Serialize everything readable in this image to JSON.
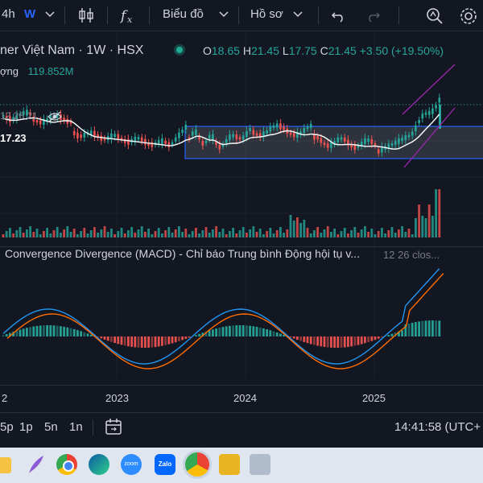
{
  "toolbar": {
    "interval": "4h",
    "interval_active": "W",
    "chart_type_label": "Biểu đồ",
    "profile_label": "Hồ sơ"
  },
  "legend": {
    "symbol_title": "ner Việt Nam · 1W · HSX",
    "open_label": "O",
    "open_value": "18.65",
    "high_label": "H",
    "high_value": "21.45",
    "low_label": "L",
    "low_value": "17.75",
    "close_label": "C",
    "close_value": "21.45",
    "change": "+3.50 (+19.50%)",
    "volume_label": "ợng",
    "volume_value": "119.852M",
    "ma_label": "12 26 21",
    "ma_value": "17.23"
  },
  "macd": {
    "title": "Convergence Divergence (MACD) - Chỉ báo Trung bình Động hội tụ v...",
    "params": "12 26 clos..."
  },
  "time_axis": [
    "2",
    "2023",
    "2024",
    "2025"
  ],
  "bottombar": {
    "ranges": [
      "5p",
      "1p",
      "5n",
      "1n"
    ],
    "clock": "14:41:58 (UTC+"
  },
  "taskbar": {
    "icons": [
      "folder-icon",
      "feather-icon",
      "chrome-icon",
      "edge-icon",
      "zoom-icon",
      "zalo-icon",
      "chrome-profile-icon",
      "lock-icon",
      "snipping-icon"
    ],
    "zoom_label": "zoom",
    "zalo_label": "Zalo"
  },
  "colors": {
    "up": "#26a69a",
    "down": "#ef5350",
    "accent": "#2962ff",
    "ma_line": "#ffffff",
    "macd_line": "#2196f3",
    "signal_line": "#ff6d00",
    "channel": "#9c27b0",
    "highlight": "#22ab94"
  }
}
